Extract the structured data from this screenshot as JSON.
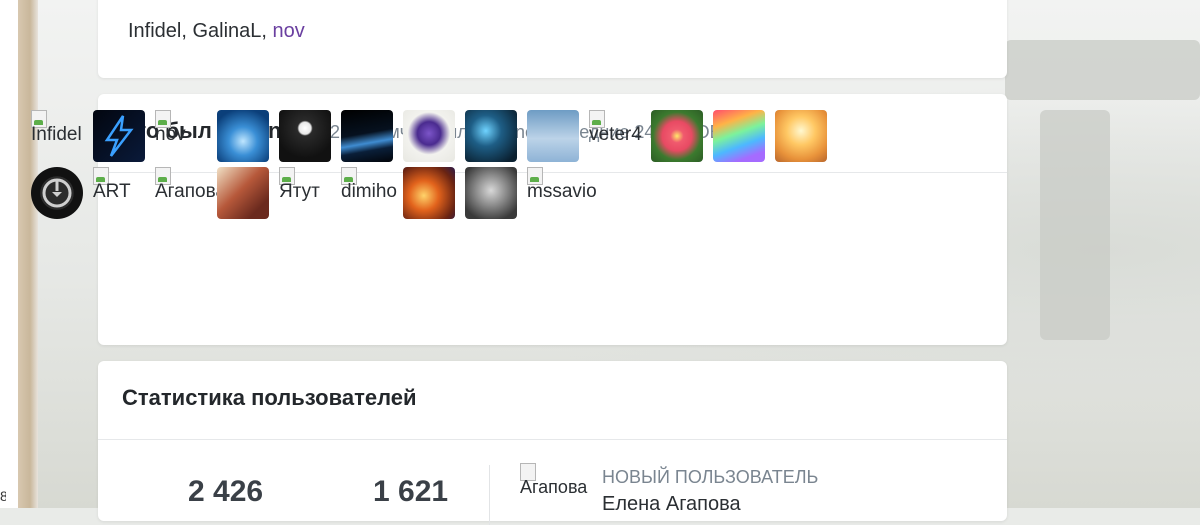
{
  "top_card": {
    "users": [
      {
        "name": "Infidel, ",
        "link": false
      },
      {
        "name": "GalinaL, ",
        "link": false
      },
      {
        "name": "nov",
        "link": true
      }
    ]
  },
  "online_card": {
    "title": "Кто был OnLine",
    "subtitle": "22 Форумчан было Online последние 24 ЧАСОВ",
    "row1": [
      {
        "alt": "Infidel",
        "type": "broken"
      },
      {
        "alt": "",
        "type": "lightning"
      },
      {
        "alt": "nov",
        "type": "broken"
      },
      {
        "alt": "",
        "type": "blue-burst"
      },
      {
        "alt": "",
        "type": "moon-tunnel"
      },
      {
        "alt": "",
        "type": "planet-horizon"
      },
      {
        "alt": "",
        "type": "iris-flower"
      },
      {
        "alt": "",
        "type": "fantasy-night"
      },
      {
        "alt": "",
        "type": "sky-clouds"
      },
      {
        "alt": "veter4",
        "type": "broken"
      },
      {
        "alt": "",
        "type": "red-flower"
      },
      {
        "alt": "",
        "type": "rainbow-swirl"
      },
      {
        "alt": "",
        "type": "sunset-hands"
      }
    ],
    "row2": [
      {
        "alt": "",
        "type": "power-button"
      },
      {
        "alt": "ART",
        "type": "broken"
      },
      {
        "alt": "Агапова",
        "type": "broken"
      },
      {
        "alt": "",
        "type": "fairy-art"
      },
      {
        "alt": "Ятут",
        "type": "broken"
      },
      {
        "alt": "dimiho",
        "type": "broken"
      },
      {
        "alt": "",
        "type": "fire-swirl"
      },
      {
        "alt": "",
        "type": "wolf"
      },
      {
        "alt": "mssavio",
        "type": "broken"
      }
    ]
  },
  "stats_card": {
    "title": "Статистика пользователей",
    "total": "2 426",
    "second": "1 621",
    "new_user_label": "НОВЫЙ ПОЛЬЗОВАТЕЛЬ",
    "new_user_name": "Елена Агапова",
    "new_user_alt": "Агапова"
  },
  "icons": {
    "broken_image": "broken-image-icon"
  }
}
